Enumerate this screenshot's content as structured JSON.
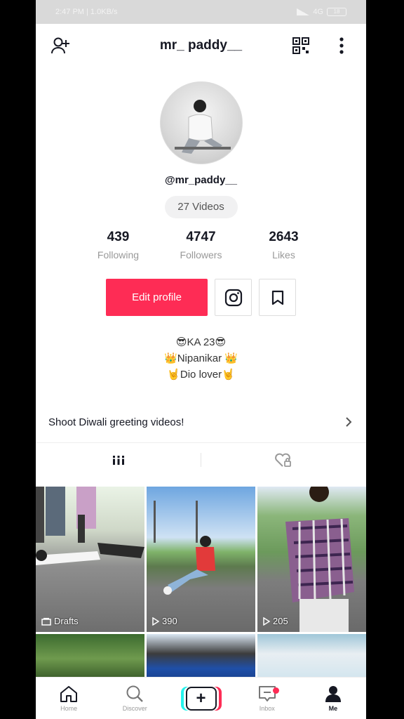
{
  "status_bar": {
    "left_text": "2:47 PM | 1.0KB/s",
    "right_text": "4G",
    "battery": "18"
  },
  "header": {
    "title": "mr_ paddy__",
    "add_user_icon": "add-user-icon",
    "qr_icon": "qr-code-icon",
    "more_icon": "more-vertical-icon"
  },
  "profile": {
    "handle": "@mr_paddy__",
    "videos_pill": "27 Videos",
    "stats": [
      {
        "value": "439",
        "label": "Following"
      },
      {
        "value": "4747",
        "label": "Followers"
      },
      {
        "value": "2643",
        "label": "Likes"
      }
    ],
    "edit_button": "Edit profile",
    "bio_lines": [
      "😎KA 23😎",
      "👑Nipanikar 👑",
      "🤘Dio lover🤘"
    ]
  },
  "promo": {
    "text": "Shoot Diwali greeting videos!"
  },
  "tabs": [
    {
      "icon": "grid-icon"
    },
    {
      "icon": "liked-videos-icon"
    }
  ],
  "videos": [
    {
      "label": "Drafts",
      "kind": "drafts"
    },
    {
      "label": "390",
      "kind": "views"
    },
    {
      "label": "205",
      "kind": "views"
    }
  ],
  "nav": [
    {
      "label": "Home",
      "icon": "home-icon"
    },
    {
      "label": "Discover",
      "icon": "search-icon"
    },
    {
      "label": "",
      "icon": "create-plus-icon"
    },
    {
      "label": "Inbox",
      "icon": "inbox-icon"
    },
    {
      "label": "Me",
      "icon": "profile-icon"
    }
  ],
  "colors": {
    "accent": "#fe2c55",
    "cyan": "#25f4ee",
    "text": "#161823"
  }
}
